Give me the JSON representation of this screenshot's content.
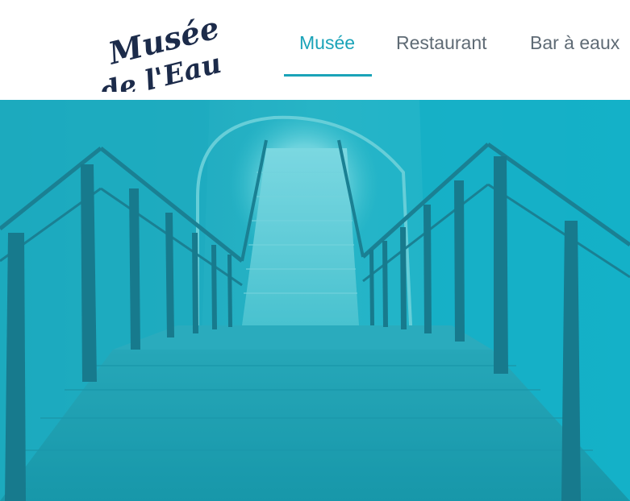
{
  "logo": {
    "line1": "Musée",
    "line2": "de l'Eau",
    "color": "#1c2b4a"
  },
  "nav": {
    "items": [
      {
        "label": "Musée",
        "active": true
      },
      {
        "label": "Restaurant",
        "active": false
      },
      {
        "label": "Bar à eaux",
        "active": false
      }
    ],
    "accent_color": "#1aa3b8",
    "text_color": "#5f6b75"
  },
  "hero": {
    "tint_color": "#1ab5c9"
  }
}
